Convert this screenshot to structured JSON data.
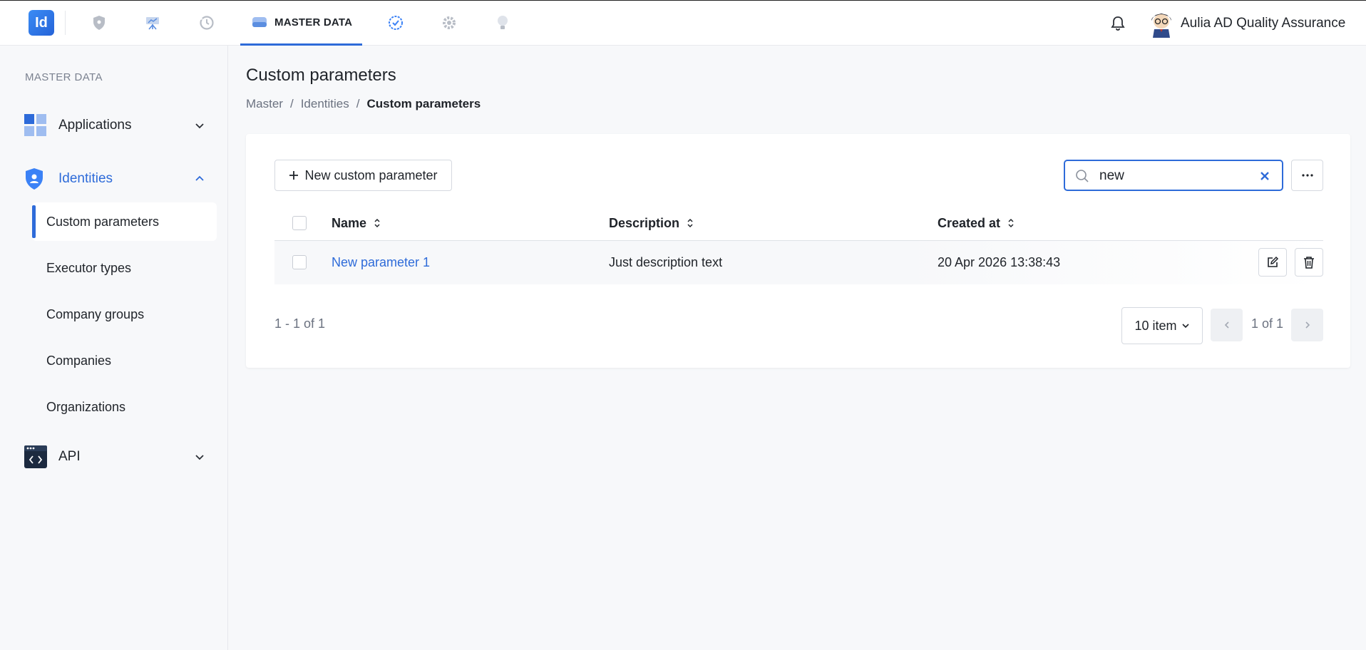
{
  "topbar": {
    "logo_text": "Id",
    "nav_icons": [
      "shield-icon",
      "presentation-icon",
      "history-icon",
      "database-icon",
      "badge-check-icon",
      "gear-icon",
      "lightbulb-icon"
    ],
    "active_tab_label": "MASTER DATA",
    "user_name": "Aulia AD Quality Assurance"
  },
  "sidebar": {
    "heading": "MASTER DATA",
    "groups": [
      {
        "label": "Applications",
        "icon": "grid-icon",
        "expanded": false
      },
      {
        "label": "Identities",
        "icon": "shield-user-icon",
        "expanded": true
      },
      {
        "label": "API",
        "icon": "code-window-icon",
        "expanded": false
      }
    ],
    "identities_items": [
      {
        "label": "Custom parameters",
        "selected": true
      },
      {
        "label": "Executor types",
        "selected": false
      },
      {
        "label": "Company groups",
        "selected": false
      },
      {
        "label": "Companies",
        "selected": false
      },
      {
        "label": "Organizations",
        "selected": false
      }
    ]
  },
  "main": {
    "title": "Custom parameters",
    "breadcrumb": [
      "Master",
      "/",
      "Identities",
      "/",
      "Custom parameters"
    ],
    "new_button_label": "New custom parameter",
    "search": {
      "value": "new",
      "placeholder": "Search"
    },
    "columns": [
      "Name",
      "Description",
      "Created at"
    ],
    "rows": [
      {
        "name": "New parameter 1",
        "description": "Just description text",
        "created_at": "20 Apr 2026 13:38:43"
      }
    ],
    "count_text": "1 - 1 of 1",
    "page_size_label": "10 item",
    "page_label": "1 of 1"
  },
  "colors": {
    "accent": "#2e6bd9",
    "text": "#1f2329",
    "muted": "#6b7280",
    "background": "#f7f8fa"
  }
}
